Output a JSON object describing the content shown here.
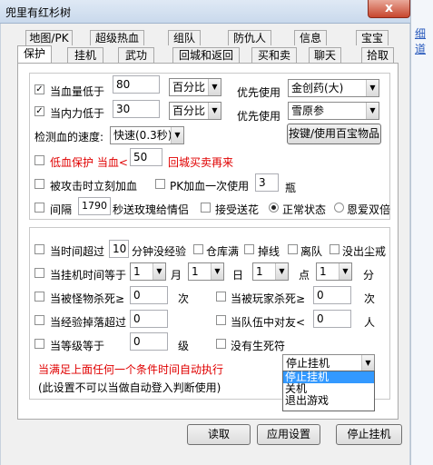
{
  "window": {
    "title": "兜里有红杉树",
    "close": "x",
    "right_link": "细道"
  },
  "tabs": {
    "row1": [
      "地图/PK",
      "超级热血",
      "组队",
      "防仇人",
      "信息",
      "宝宝"
    ],
    "row2": [
      "保护",
      "挂机",
      "武功",
      "回城和返回",
      "买和卖",
      "聊天",
      "拾取"
    ]
  },
  "protect": {
    "hp_low_label": "当血量低于",
    "hp_value": "80",
    "hp_unit": "百分比",
    "hp_priority_label": "优先使用",
    "hp_item": "金创药(大)",
    "mp_low_label": "当内力低于",
    "mp_value": "30",
    "mp_unit": "百分比",
    "mp_priority_label": "优先使用",
    "mp_item": "雪原参",
    "speed_label": "检测血的速度:",
    "speed_value": "快速(0.3秒)",
    "hotkey_button": "按键/使用百宝物品",
    "low_blood_label": "低血保护 当血<",
    "low_blood_value": "50",
    "low_blood_suffix": "回城买卖再来",
    "hit_label": "被攻击时立刻加血",
    "pk_label": "PK加血一次使用",
    "pk_value": "3",
    "pk_unit": "瓶",
    "interval_label": "间隔",
    "interval_value": "1790",
    "interval_suffix": "秒送玫瑰给情侣",
    "flower_label": "接受送花",
    "normal_label": "正常状态",
    "love_label": "恩爱双倍"
  },
  "conditions": {
    "time_label": "当时间超过",
    "time_value": "10",
    "time_suffix": "分钟没经验",
    "warehouse_label": "仓库满",
    "offline_label": "掉线",
    "leave_team_label": "离队",
    "no_ring_label": "没出尘戒",
    "hang_time_label": "当挂机时间等于",
    "month_value": "1",
    "month_label": "月",
    "day_value": "1",
    "day_label": "日",
    "hour_value": "1",
    "hour_label": "点",
    "minute_value": "1",
    "minute_label": "分",
    "monster_kill_label": "当被怪物杀死≥",
    "monster_kill_value": "0",
    "monster_kill_unit": "次",
    "player_kill_label": "当被玩家杀死≥",
    "player_kill_value": "0",
    "player_kill_unit": "次",
    "exp_drop_label": "当经验掉落超过",
    "exp_drop_value": "0",
    "enemy_label": "当队伍中对友<",
    "enemy_value": "0",
    "enemy_unit": "人",
    "level_label": "当等级等于",
    "level_value": "0",
    "level_unit": "级",
    "no_life_label": "没有生死符",
    "auto_label": "当满足上面任何一个条件时间自动执行",
    "note_label": "(此设置不可以当做自动登入判断使用)",
    "action_value": "停止挂机",
    "action_options": [
      "停止挂机",
      "关机",
      "退出游戏"
    ]
  },
  "footer": {
    "read": "读取",
    "apply": "应用设置",
    "stop": "停止挂机"
  }
}
